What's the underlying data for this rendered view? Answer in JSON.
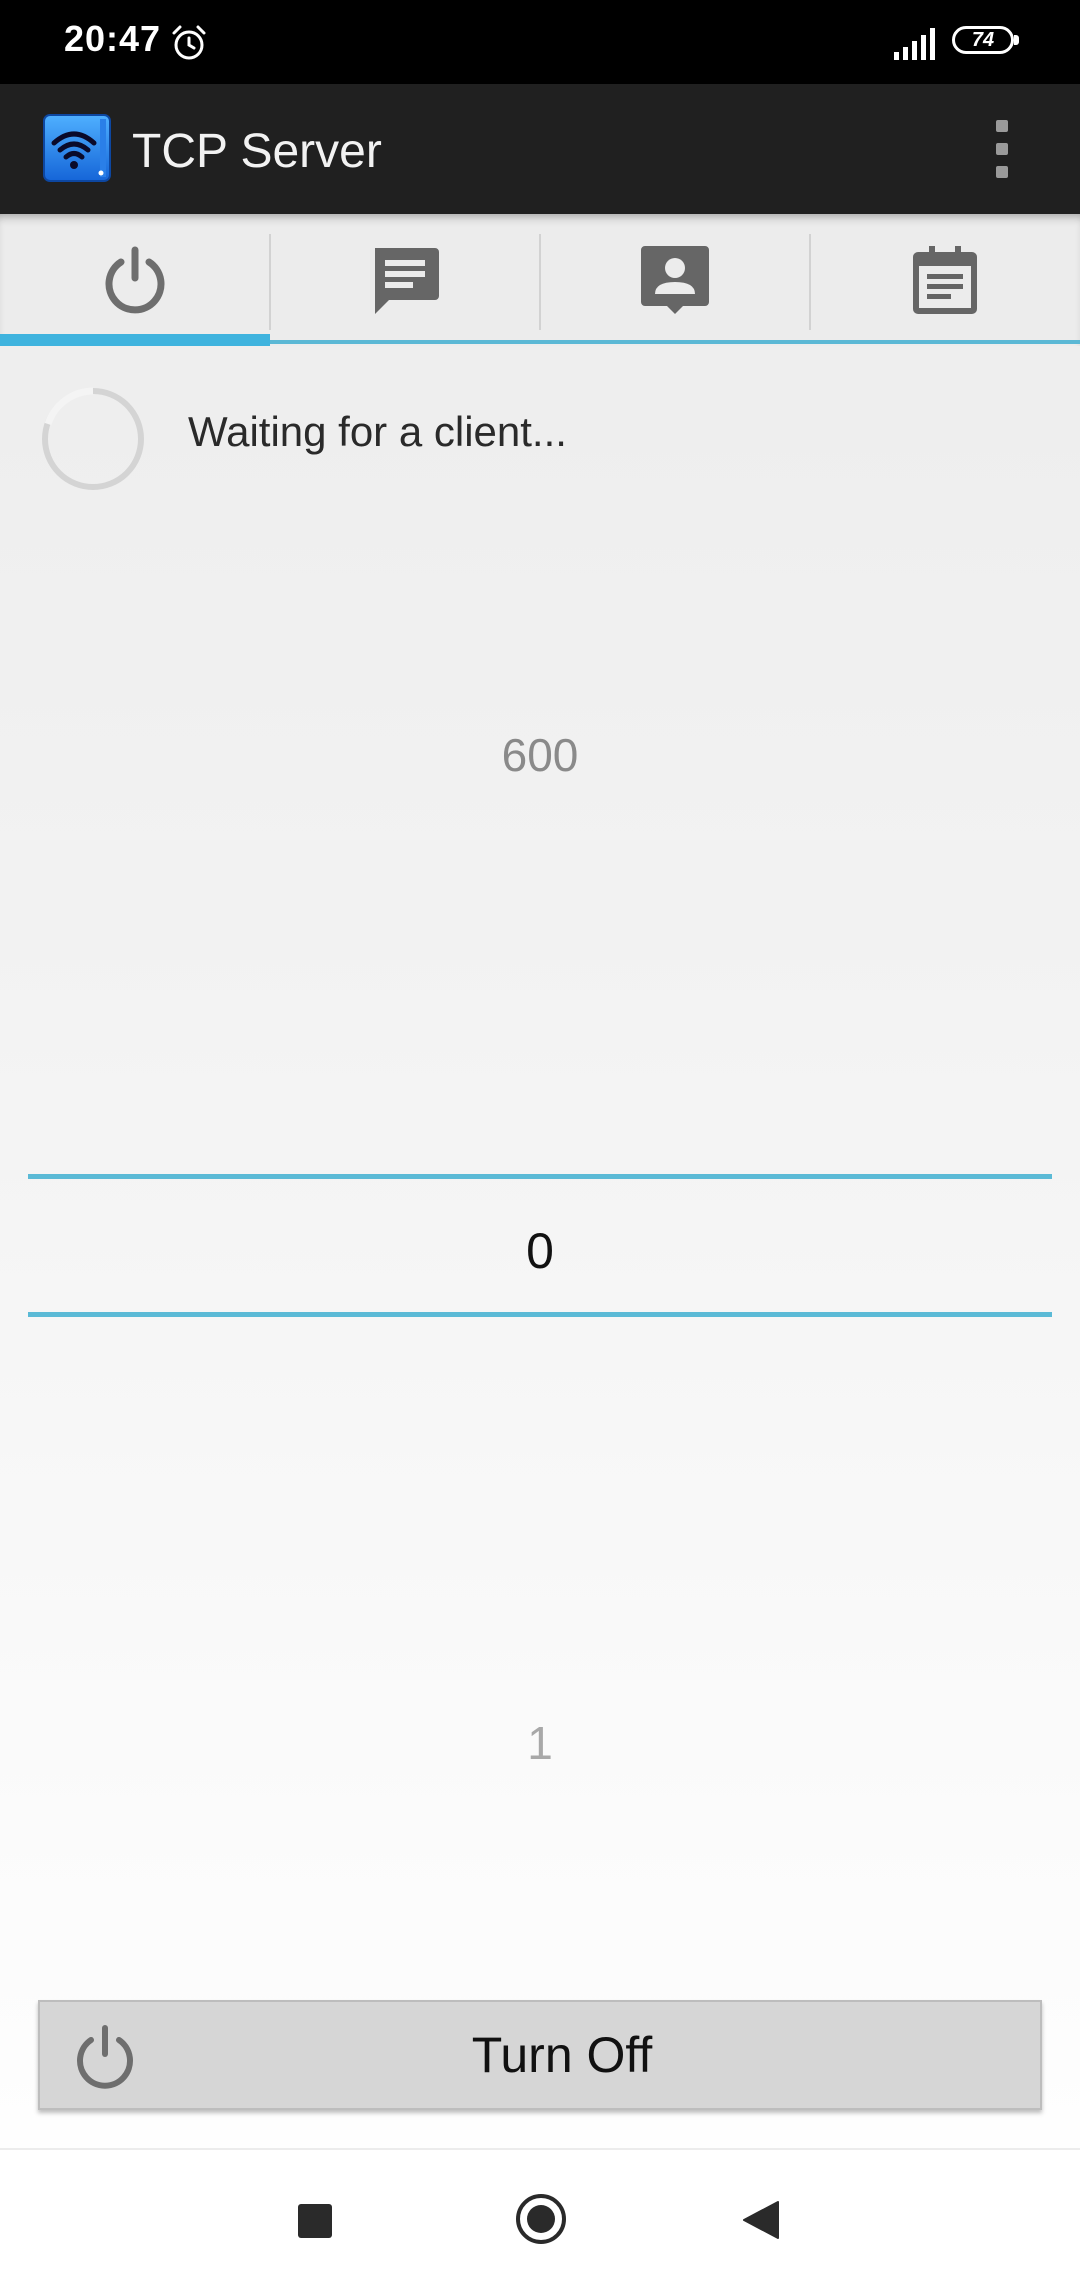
{
  "status_bar": {
    "time": "20:47",
    "battery_level": "74",
    "icons": [
      "alarm-icon",
      "signal-icon",
      "battery-icon"
    ]
  },
  "app_bar": {
    "title": "TCP Server",
    "icons": [
      "wifi-app-icon",
      "more-vert-icon"
    ]
  },
  "tabs": [
    {
      "icon": "power-icon",
      "active": true
    },
    {
      "icon": "chat-icon",
      "active": false
    },
    {
      "icon": "contact-icon",
      "active": false
    },
    {
      "icon": "calendar-icon",
      "active": false
    }
  ],
  "status": {
    "message": "Waiting for a client..."
  },
  "number_picker": {
    "previous": "600",
    "current": "0",
    "next": "1"
  },
  "turn_off_button": {
    "label": "Turn Off"
  },
  "colors": {
    "accent": "#3fb3de",
    "app_bar": "#202020",
    "status_bar": "#000000"
  }
}
